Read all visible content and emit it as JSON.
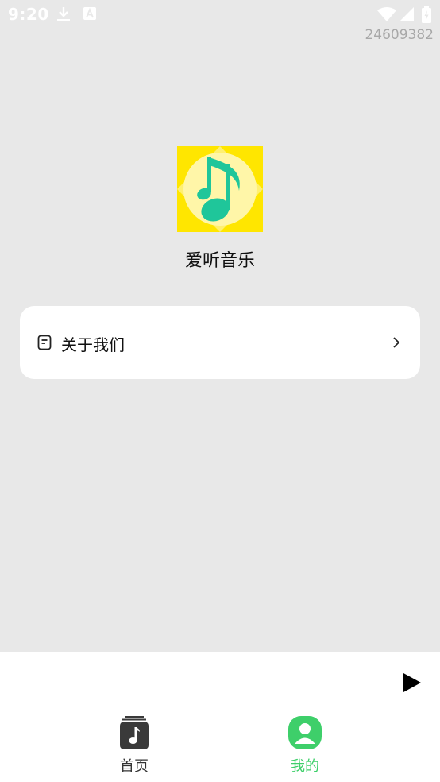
{
  "status_bar": {
    "time": "9:20",
    "build_number": "24609382"
  },
  "app": {
    "name": "爱听音乐",
    "logo_icon": "music-note-icon",
    "logo_bg_color": "#ffe600",
    "logo_note_color": "#1fc69a"
  },
  "menu": {
    "items": [
      {
        "label": "关于我们",
        "icon": "document-icon"
      }
    ]
  },
  "player": {
    "play_icon": "play-icon"
  },
  "tab_bar": {
    "tabs": [
      {
        "label": "首页",
        "icon": "music-library-icon",
        "active": false
      },
      {
        "label": "我的",
        "icon": "profile-icon",
        "active": true
      }
    ],
    "active_color": "#3ecf6a"
  }
}
